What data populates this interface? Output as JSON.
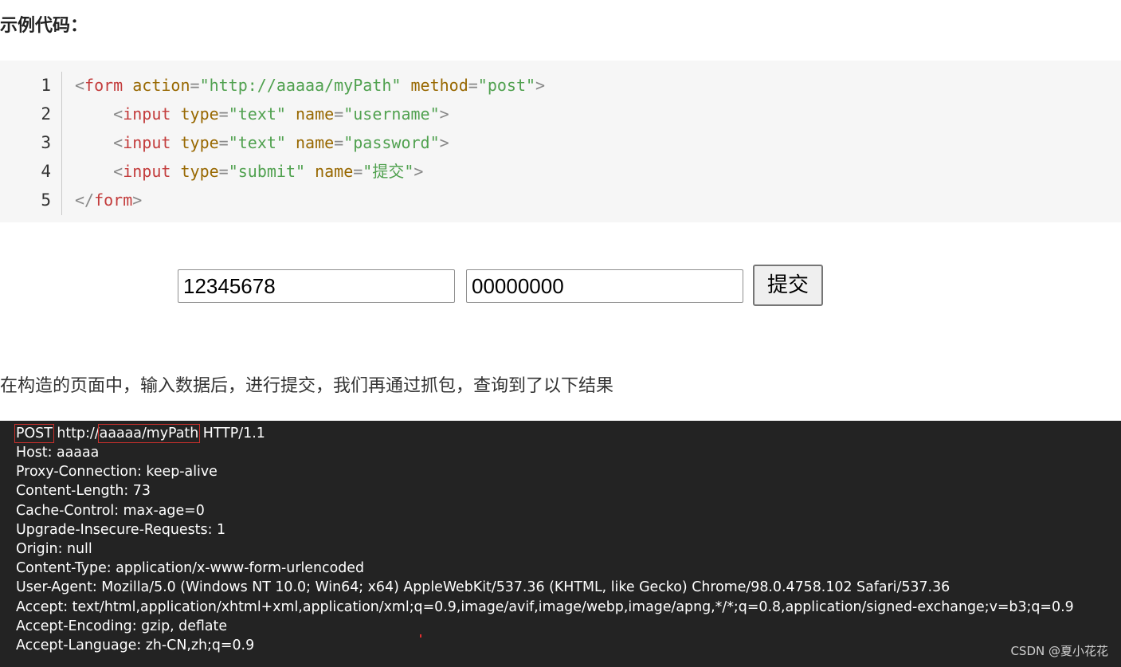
{
  "heading": "示例代码：",
  "code": {
    "line_numbers": [
      "1",
      "2",
      "3",
      "4",
      "5"
    ],
    "lines": [
      [
        {
          "text": "<",
          "kind": "punct"
        },
        {
          "text": "form",
          "kind": "tag"
        },
        {
          "text": " ",
          "kind": "punct"
        },
        {
          "text": "action",
          "kind": "attr"
        },
        {
          "text": "=",
          "kind": "punct"
        },
        {
          "text": "\"http://aaaaa/myPath\"",
          "kind": "string"
        },
        {
          "text": " ",
          "kind": "punct"
        },
        {
          "text": "method",
          "kind": "attr"
        },
        {
          "text": "=",
          "kind": "punct"
        },
        {
          "text": "\"post\"",
          "kind": "string"
        },
        {
          "text": ">",
          "kind": "punct"
        }
      ],
      [
        {
          "text": "    <",
          "kind": "punct"
        },
        {
          "text": "input",
          "kind": "tag"
        },
        {
          "text": " ",
          "kind": "punct"
        },
        {
          "text": "type",
          "kind": "attr"
        },
        {
          "text": "=",
          "kind": "punct"
        },
        {
          "text": "\"text\"",
          "kind": "string"
        },
        {
          "text": " ",
          "kind": "punct"
        },
        {
          "text": "name",
          "kind": "attr"
        },
        {
          "text": "=",
          "kind": "punct"
        },
        {
          "text": "\"username\"",
          "kind": "string"
        },
        {
          "text": ">",
          "kind": "punct"
        }
      ],
      [
        {
          "text": "    <",
          "kind": "punct"
        },
        {
          "text": "input",
          "kind": "tag"
        },
        {
          "text": " ",
          "kind": "punct"
        },
        {
          "text": "type",
          "kind": "attr"
        },
        {
          "text": "=",
          "kind": "punct"
        },
        {
          "text": "\"text\"",
          "kind": "string"
        },
        {
          "text": " ",
          "kind": "punct"
        },
        {
          "text": "name",
          "kind": "attr"
        },
        {
          "text": "=",
          "kind": "punct"
        },
        {
          "text": "\"password\"",
          "kind": "string"
        },
        {
          "text": ">",
          "kind": "punct"
        }
      ],
      [
        {
          "text": "    <",
          "kind": "punct"
        },
        {
          "text": "input",
          "kind": "tag"
        },
        {
          "text": " ",
          "kind": "punct"
        },
        {
          "text": "type",
          "kind": "attr"
        },
        {
          "text": "=",
          "kind": "punct"
        },
        {
          "text": "\"submit\"",
          "kind": "string"
        },
        {
          "text": " ",
          "kind": "punct"
        },
        {
          "text": "name",
          "kind": "attr"
        },
        {
          "text": "=",
          "kind": "punct"
        },
        {
          "text": "\"提交\"",
          "kind": "string"
        },
        {
          "text": ">",
          "kind": "punct"
        }
      ],
      [
        {
          "text": "</",
          "kind": "punct"
        },
        {
          "text": "form",
          "kind": "tag"
        },
        {
          "text": ">",
          "kind": "punct"
        }
      ]
    ]
  },
  "form": {
    "username_value": "12345678",
    "password_value": "00000000",
    "submit_label": "提交"
  },
  "paragraph": "在构造的页面中，输入数据后，进行提交，我们再通过抓包，查询到了以下结果",
  "http": {
    "request_line": {
      "method": "POST",
      "scheme": " http://",
      "path": "aaaaa/myPath",
      "version": " HTTP/1.1"
    },
    "headers": [
      "Host: aaaaa",
      "Proxy-Connection: keep-alive",
      "Content-Length: 73",
      "Cache-Control: max-age=0",
      "Upgrade-Insecure-Requests: 1",
      "Origin: null",
      "Content-Type: application/x-www-form-urlencoded",
      "User-Agent: Mozilla/5.0 (Windows NT 10.0; Win64; x64) AppleWebKit/537.36 (KHTML, like Gecko) Chrome/98.0.4758.102 Safari/537.36",
      "Accept: text/html,application/xhtml+xml,application/xml;q=0.9,image/avif,image/webp,image/apng,*/*;q=0.8,application/signed-exchange;v=b3;q=0.9",
      "Accept-Encoding: gzip, deflate",
      "Accept-Language: zh-CN,zh;q=0.9"
    ],
    "highlight_color": "#c8302c"
  },
  "watermark": "CSDN @夏小花花",
  "colors": {
    "code_bg": "#f6f6f6",
    "tag": "#c33c3c",
    "attr": "#986801",
    "string": "#50a14f",
    "punct": "#888888",
    "http_bg": "#232323"
  }
}
